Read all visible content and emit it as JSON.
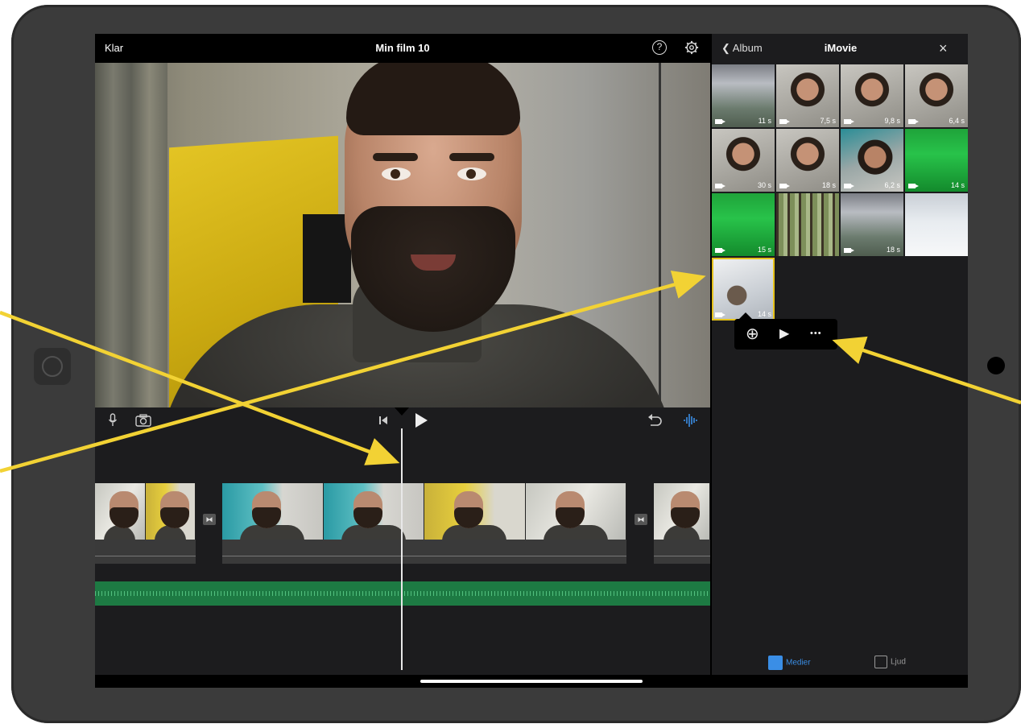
{
  "editor": {
    "done_label": "Klar",
    "title": "Min film 10",
    "help_icon": "?"
  },
  "browser": {
    "back_label": "Album",
    "title": "iMovie",
    "close_icon": "×",
    "tiles": [
      {
        "kind": "gym",
        "duration": "11 s"
      },
      {
        "kind": "face",
        "duration": "7,5 s"
      },
      {
        "kind": "face",
        "duration": "9,8 s"
      },
      {
        "kind": "face",
        "duration": "6,4 s"
      },
      {
        "kind": "face",
        "duration": "30 s"
      },
      {
        "kind": "face",
        "duration": "18 s"
      },
      {
        "kind": "face2",
        "duration": "6,2 s"
      },
      {
        "kind": "green",
        "duration": "14 s"
      },
      {
        "kind": "green",
        "duration": "15 s"
      },
      {
        "kind": "forest",
        "duration": ""
      },
      {
        "kind": "gym",
        "duration": "18 s"
      },
      {
        "kind": "snow",
        "duration": ""
      },
      {
        "kind": "selected",
        "duration": "14 s"
      }
    ],
    "popup": {
      "add_icon": "⊕",
      "play_icon": "▶",
      "more_icon": "•••"
    },
    "tabs": {
      "media_label": "Medier",
      "audio_label": "Ljud"
    }
  },
  "colors": {
    "accent": "#3a8ee6",
    "arrow": "#f2d234",
    "selection": "#e5c21b",
    "audio_track": "#1d7a43"
  }
}
